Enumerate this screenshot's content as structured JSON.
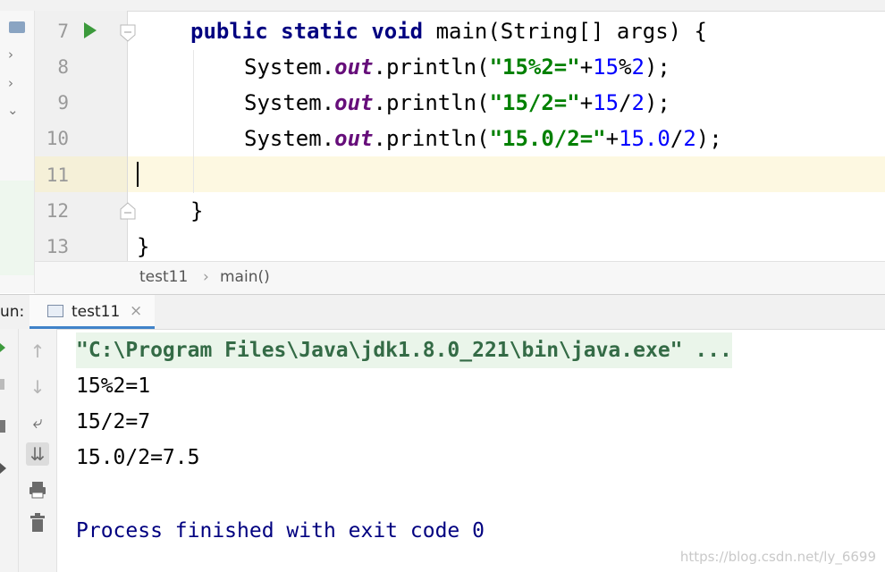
{
  "editor": {
    "lines": [
      {
        "num": "7"
      },
      {
        "num": "8"
      },
      {
        "num": "9"
      },
      {
        "num": "10"
      },
      {
        "num": "11"
      },
      {
        "num": "12"
      },
      {
        "num": "13"
      }
    ],
    "code": {
      "l7": {
        "kw1": "public",
        "kw2": "static",
        "kw3": "void",
        "rest": "main(String[] args) {"
      },
      "l8": {
        "pre": "System.",
        "field": "out",
        "call": ".println(",
        "str": "\"15%2=\"",
        "plus": "+",
        "n1": "15",
        "op": "%",
        "n2": "2",
        "end": ");"
      },
      "l9": {
        "pre": "System.",
        "field": "out",
        "call": ".println(",
        "str": "\"15/2=\"",
        "plus": "+",
        "n1": "15",
        "op": "/",
        "n2": "2",
        "end": ");"
      },
      "l10": {
        "pre": "System.",
        "field": "out",
        "call": ".println(",
        "str": "\"15.0/2=\"",
        "plus": "+",
        "n1": "15.0",
        "op": "/",
        "n2": "2",
        "end": ");"
      },
      "l12": {
        "text": "}"
      },
      "l13": {
        "text": "}"
      }
    }
  },
  "breadcrumb": {
    "class": "test11",
    "sep": "›",
    "method": "main()"
  },
  "run": {
    "label": "un:",
    "tab": "test11",
    "tab_close": "×",
    "output": {
      "cmd": "\"C:\\Program Files\\Java\\jdk1.8.0_221\\bin\\java.exe\" ...",
      "line1": "15%2=1",
      "line2": "15/2=7",
      "line3": "15.0/2=7.5",
      "finish": "Process finished with exit code 0"
    }
  },
  "watermark": "https://blog.csdn.net/ly_6699",
  "icons": {
    "run_gutter": "run-arrow-icon",
    "fold": "fold-icon",
    "up": "up-arrow-icon",
    "down": "down-arrow-icon",
    "wrap": "soft-wrap-icon",
    "scroll": "scroll-to-end-icon",
    "print": "print-icon",
    "trash": "trash-icon"
  },
  "colors": {
    "keyword": "#000080",
    "string": "#008000",
    "number": "#0000ff",
    "field": "#660e7a",
    "accent": "#4083c9"
  }
}
